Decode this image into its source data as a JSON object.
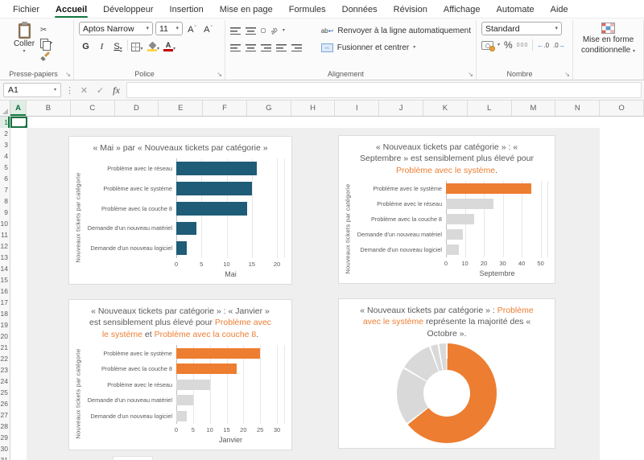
{
  "colors": {
    "accent_green": "#107C41",
    "orange": "#ED7D31",
    "teal": "#1E5C78",
    "bar_gray": "#D9D9D9",
    "title_gray": "#595959"
  },
  "ribbon": {
    "tabs": [
      "Fichier",
      "Accueil",
      "Développeur",
      "Insertion",
      "Mise en page",
      "Formules",
      "Données",
      "Révision",
      "Affichage",
      "Automate",
      "Aide"
    ],
    "active_tab": "Accueil",
    "clipboard": {
      "group_label": "Presse-papiers",
      "paste_label": "Coller"
    },
    "font": {
      "group_label": "Police",
      "name": "Aptos Narrow",
      "size": "11",
      "bold": "G",
      "italic": "I",
      "underline": "S",
      "grow": "A",
      "shrink": "A"
    },
    "alignment": {
      "group_label": "Alignement",
      "wrap_label": "Renvoyer à la ligne automatiquement",
      "merge_label": "Fusionner et centrer"
    },
    "number": {
      "group_label": "Nombre",
      "format": "Standard",
      "percent": "%",
      "thousands": "000"
    },
    "styles": {
      "conditional_label_line1": "Mise en forme",
      "conditional_label_line2": "conditionnelle"
    }
  },
  "formula_bar": {
    "name_box": "A1",
    "cancel": "✕",
    "confirm": "✓",
    "fx": "fx"
  },
  "sheet": {
    "columns": [
      "A",
      "B",
      "C",
      "D",
      "E",
      "F",
      "G",
      "H",
      "I",
      "J",
      "K",
      "L",
      "M",
      "N",
      "O"
    ],
    "rows": [
      1,
      2,
      3,
      4,
      5,
      6,
      7,
      8,
      9,
      10,
      11,
      12,
      13,
      14,
      15,
      16,
      17,
      18,
      19,
      20,
      21,
      22,
      23,
      24,
      25,
      26,
      27,
      28,
      29,
      30,
      31
    ]
  },
  "chart_data": [
    {
      "type": "bar",
      "title_segments": [
        {
          "t": "« Mai » par « Nouveaux tickets par catégorie »"
        }
      ],
      "categories": [
        "Problème avec le réseau",
        "Problème avec le système",
        "Problème avec la couche 8",
        "Demande d'un nouveau matériel",
        "Demande d'un nouveau logiciel"
      ],
      "values": [
        16,
        15,
        14,
        4,
        2
      ],
      "colors": [
        "#1E5C78",
        "#1E5C78",
        "#1E5C78",
        "#1E5C78",
        "#1E5C78"
      ],
      "xticks": [
        0,
        5,
        10,
        15,
        20
      ],
      "xlim": [
        0,
        20
      ],
      "xlabel": "Mai",
      "ylabel": "Nouveaux tickets par catégorie",
      "grid": true,
      "legend": "none"
    },
    {
      "type": "bar",
      "title_segments": [
        {
          "t": "« Nouveaux tickets par catégorie » : « Septembre » est sensiblement plus élevé pour "
        },
        {
          "t": "Problème avec le système",
          "c": "#ED7D31"
        },
        {
          "t": "."
        }
      ],
      "categories": [
        "Problème avec le système",
        "Problème avec le réseau",
        "Problème avec la couche 8",
        "Demande d'un nouveau matériel",
        "Demande d'un nouveau logiciel"
      ],
      "values": [
        45,
        25,
        15,
        9,
        7
      ],
      "colors": [
        "#ED7D31",
        "#D9D9D9",
        "#D9D9D9",
        "#D9D9D9",
        "#D9D9D9"
      ],
      "xticks": [
        0,
        10,
        20,
        30,
        40,
        50
      ],
      "xlim": [
        0,
        50
      ],
      "xlabel": "Septembre",
      "ylabel": "Nouveaux tickets par catégorie",
      "grid": true,
      "legend": "none"
    },
    {
      "type": "bar",
      "title_segments": [
        {
          "t": "« Nouveaux tickets par catégorie » : « Janvier » est sensiblement plus élevé pour "
        },
        {
          "t": "Problème avec le système",
          "c": "#ED7D31"
        },
        {
          "t": " et "
        },
        {
          "t": "Problème avec la couche 8",
          "c": "#ED7D31"
        },
        {
          "t": "."
        }
      ],
      "categories": [
        "Problème avec le système",
        "Problème avec la couche 8",
        "Problème avec le réseau",
        "Demande d'un nouveau matériel",
        "Demande d'un nouveau logiciel"
      ],
      "values": [
        25,
        18,
        10,
        5,
        3
      ],
      "colors": [
        "#ED7D31",
        "#ED7D31",
        "#D9D9D9",
        "#D9D9D9",
        "#D9D9D9"
      ],
      "xticks": [
        0,
        5,
        10,
        15,
        20,
        25,
        30
      ],
      "xlim": [
        0,
        30
      ],
      "xlabel": "Janvier",
      "ylabel": "Nouveaux tickets par catégorie",
      "grid": true,
      "legend": "none"
    },
    {
      "type": "donut",
      "title_segments": [
        {
          "t": "« Nouveaux tickets par catégorie » : "
        },
        {
          "t": "Problème avec le système",
          "c": "#ED7D31"
        },
        {
          "t": " représente la majorité des « Octobre »."
        }
      ],
      "slices": [
        {
          "label": "Problème avec le système",
          "value": 64.5,
          "color": "#ED7D31"
        },
        {
          "label": "",
          "value": 19,
          "color": "#D9D9D9"
        },
        {
          "label": "",
          "value": 11,
          "color": "#D9D9D9"
        },
        {
          "label": "",
          "value": 2.75,
          "color": "#D9D9D9"
        },
        {
          "label": "",
          "value": 2.75,
          "color": "#D9D9D9"
        }
      ],
      "legend": "none"
    }
  ]
}
